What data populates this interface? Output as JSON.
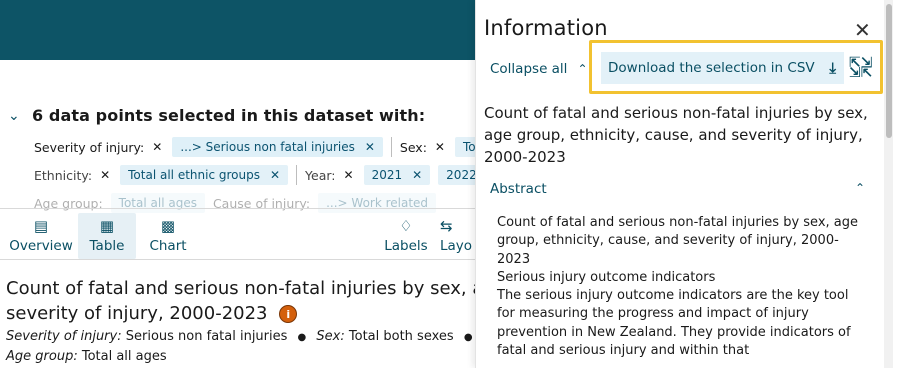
{
  "selection": {
    "title": "6 data points selected in this dataset with:",
    "row1": {
      "severity_label": "Severity of injury:",
      "severity_chip": "...> Serious non fatal injuries",
      "sex_label": "Sex:",
      "sex_chip": "Total bot"
    },
    "row2": {
      "ethnicity_label": "Ethnicity:",
      "ethnicity_chip": "Total all ethnic groups",
      "year_label": "Year:",
      "year_chip_1": "2021",
      "year_chip_2": "2022"
    },
    "row3": {
      "age_label": "Age group:",
      "age_chip": "Total all ages",
      "cause_label": "Cause of injury:",
      "cause_chip": "...> Work related"
    }
  },
  "nav": {
    "overview": "Overview",
    "table": "Table",
    "chart": "Chart",
    "labels": "Labels",
    "layout": "Layo"
  },
  "content": {
    "title_line1": "Count of fatal and serious non-fatal injuries by sex, age",
    "title_line2": "severity of injury, 2000-2023",
    "info_badge": "i",
    "meta_severity_label": "Severity of injury:",
    "meta_severity_value": "Serious non fatal injuries",
    "meta_sex_label": "Sex:",
    "meta_sex_value": "Total both sexes",
    "meta_age_label": "Age group:",
    "meta_age_value": "Total all ages"
  },
  "panel": {
    "title": "Information",
    "collapse_all": "Collapse all",
    "download": "Download the selection in CSV",
    "dataset_title": "Count of fatal and serious non-fatal injuries by sex, age group, ethnicity, cause, and severity of injury, 2000-2023",
    "abstract_label": "Abstract",
    "abstract": {
      "p1": "Count of fatal and serious non-fatal injuries by sex, age group, ethnicity, cause, and severity of injury, 2000-2023",
      "p2": "Serious injury outcome indicators",
      "p3": "The serious injury outcome indicators are the key tool for measuring the progress and impact of injury prevention in New Zealand. They provide indicators of fatal and serious injury and within that"
    }
  },
  "icons": {
    "collapse_chevron": "chevron-down-icon",
    "overview": "list-icon",
    "table": "table-icon",
    "chart": "bar-chart-icon",
    "labels": "tag-icon",
    "layout": "swap-icon",
    "download": "download-icon",
    "expand": "expand-icon",
    "close": "close-icon"
  },
  "colors": {
    "header": "#0d5466",
    "accent": "#0a4f63",
    "chip_bg": "#e3f1f8",
    "highlight": "#f2c230",
    "badge": "#d4600c"
  }
}
